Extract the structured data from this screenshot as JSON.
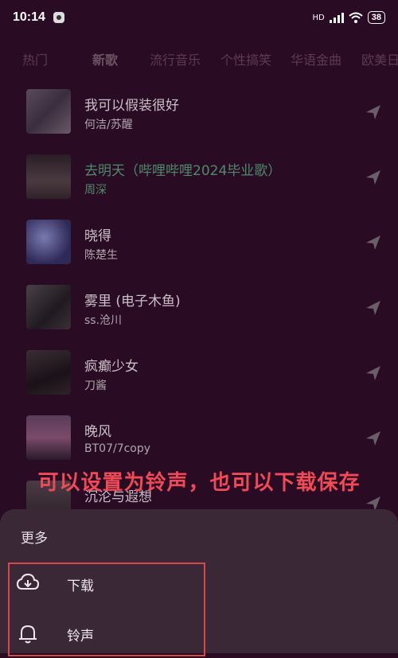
{
  "status": {
    "time": "10:14",
    "battery": "38",
    "network": "HD"
  },
  "tabs": [
    {
      "label": "热门",
      "active": false
    },
    {
      "label": "新歌",
      "active": true
    },
    {
      "label": "流行音乐",
      "active": false
    },
    {
      "label": "个性搞笑",
      "active": false
    },
    {
      "label": "华语金曲",
      "active": false
    },
    {
      "label": "欧美日",
      "active": false
    }
  ],
  "songs": [
    {
      "title": "我可以假装很好",
      "artist": "何洁/苏醒",
      "playing": false
    },
    {
      "title": "去明天（哔哩哔哩2024毕业歌）",
      "artist": "周深",
      "playing": true
    },
    {
      "title": "晓得",
      "artist": "陈楚生",
      "playing": false
    },
    {
      "title": "雾里 (电子木鱼)",
      "artist": "ss.沧川",
      "playing": false
    },
    {
      "title": "疯癫少女",
      "artist": "刀酱",
      "playing": false
    },
    {
      "title": "晚风",
      "artist": "BT07/7copy",
      "playing": false
    },
    {
      "title": "沉沦与遐想",
      "artist": "",
      "playing": false
    }
  ],
  "caption": "可以设置为铃声，也可以下载保存",
  "sheet": {
    "title": "更多",
    "items": [
      {
        "label": "下载",
        "icon": "download-cloud-icon"
      },
      {
        "label": "铃声",
        "icon": "bell-icon"
      }
    ]
  },
  "colors": {
    "background": "#2a0b24",
    "sheet": "#3a2837",
    "playing": "#4f8a6a",
    "caption": "#f04a57",
    "highlight": "#d44a4a"
  }
}
